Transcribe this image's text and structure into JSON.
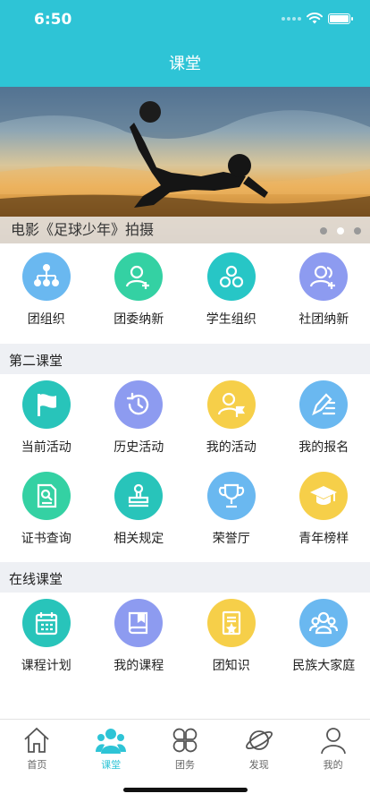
{
  "status": {
    "time": "6:50"
  },
  "nav": {
    "title": "课堂"
  },
  "banner": {
    "caption": "电影《足球少年》拍摄"
  },
  "top_grid": [
    {
      "label": "团组织",
      "icon": "org-chart-icon",
      "color": "#6ab8f0"
    },
    {
      "label": "团委纳新",
      "icon": "user-add-icon",
      "color": "#34d1a3"
    },
    {
      "label": "学生组织",
      "icon": "group-circles-icon",
      "color": "#27c6c6"
    },
    {
      "label": "社团纳新",
      "icon": "users-add-icon",
      "color": "#8d9bf0"
    }
  ],
  "sections": {
    "second": "第二课堂",
    "online": "在线课堂"
  },
  "second_row1": [
    {
      "label": "当前活动",
      "icon": "flag-icon",
      "color": "#28c4ba"
    },
    {
      "label": "历史活动",
      "icon": "history-icon",
      "color": "#8d9bf0"
    },
    {
      "label": "我的活动",
      "icon": "user-flag-icon",
      "color": "#f6cf49"
    },
    {
      "label": "我的报名",
      "icon": "edit-list-icon",
      "color": "#6ab8f0"
    }
  ],
  "second_row2": [
    {
      "label": "证书查询",
      "icon": "certificate-search-icon",
      "color": "#34d1a3"
    },
    {
      "label": "相关规定",
      "icon": "stamp-icon",
      "color": "#28c4ba"
    },
    {
      "label": "荣誉厅",
      "icon": "trophy-icon",
      "color": "#6ab8f0"
    },
    {
      "label": "青年榜样",
      "icon": "graduation-cap-icon",
      "color": "#f6cf49"
    }
  ],
  "online_row": [
    {
      "label": "课程计划",
      "icon": "calendar-icon",
      "color": "#28c4ba"
    },
    {
      "label": "我的课程",
      "icon": "book-icon",
      "color": "#8d9bf0"
    },
    {
      "label": "团知识",
      "icon": "document-star-icon",
      "color": "#f6cf49"
    },
    {
      "label": "民族大家庭",
      "icon": "family-icon",
      "color": "#6ab8f0"
    }
  ],
  "tabs": [
    {
      "label": "首页",
      "icon": "home-icon"
    },
    {
      "label": "课堂",
      "icon": "classroom-icon",
      "active": true
    },
    {
      "label": "团务",
      "icon": "grid-petals-icon"
    },
    {
      "label": "发现",
      "icon": "planet-icon"
    },
    {
      "label": "我的",
      "icon": "person-icon"
    }
  ],
  "colors": {
    "accent": "#2ec4d6",
    "section_bg": "#eef0f4"
  }
}
